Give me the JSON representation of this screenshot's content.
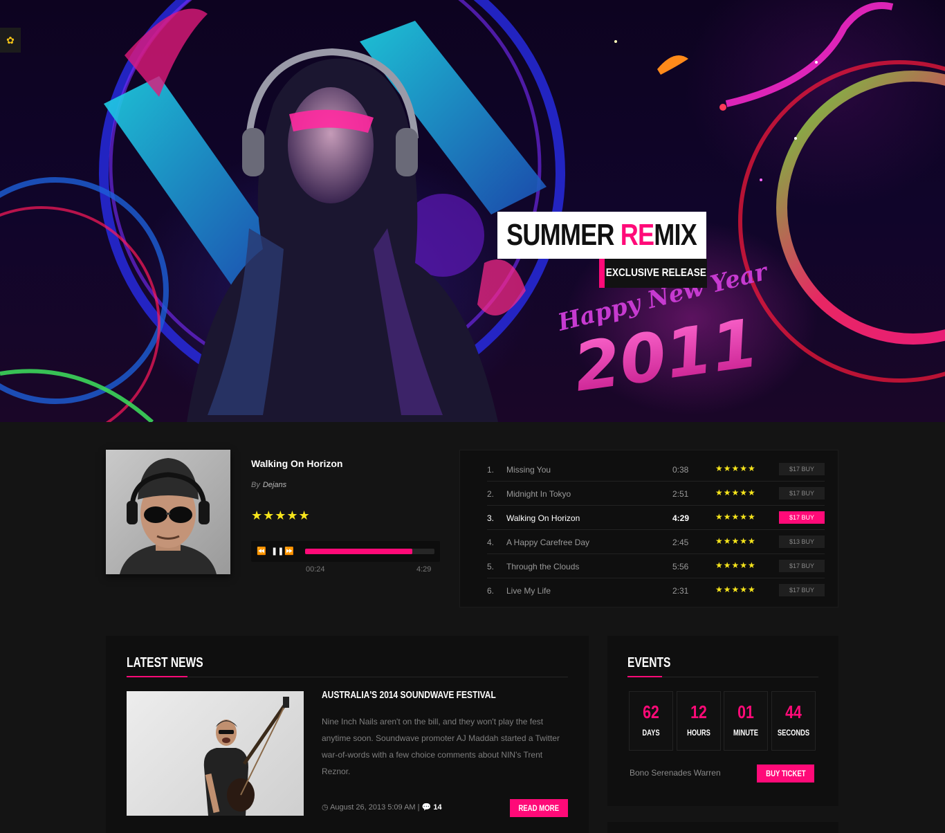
{
  "hero": {
    "title_part1": "SUMMER ",
    "title_accent": "RE",
    "title_part2": "MIX",
    "subtitle": "EXCLUSIVE RELEASE",
    "art_text_line1": "Happy New Year",
    "art_text_year": "2011",
    "side_widget_icon": "flower-icon"
  },
  "player": {
    "title": "Walking On Horizon",
    "by_label": "By",
    "artist": "Dejans",
    "rating": "★★★★★",
    "rating_value": 5,
    "prev_icon": "⏪",
    "pause_icon": "❚❚",
    "next_icon": "⏩",
    "progress_fraction": 0.83,
    "time_current": "00:24",
    "time_total": "4:29"
  },
  "playlist": {
    "tracks": [
      {
        "num": "1.",
        "name": "Missing You",
        "duration": "0:38",
        "rating": "★★★★★",
        "buy": "$17 BUY"
      },
      {
        "num": "2.",
        "name": "Midnight In Tokyo",
        "duration": "2:51",
        "rating": "★★★★★",
        "buy": "$17 BUY"
      },
      {
        "num": "3.",
        "name": "Walking On Horizon",
        "duration": "4:29",
        "rating": "★★★★★",
        "buy": "$17 BUY"
      },
      {
        "num": "4.",
        "name": "A Happy Carefree Day",
        "duration": "2:45",
        "rating": "★★★★★",
        "buy": "$13 BUY"
      },
      {
        "num": "5.",
        "name": "Through the Clouds",
        "duration": "5:56",
        "rating": "★★★★★",
        "buy": "$17 BUY"
      },
      {
        "num": "6.",
        "name": "Live My Life",
        "duration": "2:31",
        "rating": "★★★★★",
        "buy": "$17 BUY"
      }
    ],
    "active_index": 2
  },
  "news": {
    "section_title": "LATEST NEWS",
    "headline": "AUSTRALIA'S 2014 SOUNDWAVE FESTIVAL",
    "body": "Nine Inch Nails aren't on the bill, and they won't play the fest anytime soon. Soundwave promoter AJ Maddah started a Twitter war-of-words with a few choice comments about NIN's Trent Reznor.",
    "date": "August 26, 2013 5:09 AM",
    "separator": "|",
    "comments": "14",
    "read_more": "READ MORE"
  },
  "events": {
    "section_title": "EVENTS",
    "countdown": [
      {
        "value": "62",
        "label": "DAYS"
      },
      {
        "value": "12",
        "label": "HOURS"
      },
      {
        "value": "01",
        "label": "MINUTE"
      },
      {
        "value": "44",
        "label": "SECONDS"
      }
    ],
    "event_name": "Bono Serenades Warren",
    "buy_ticket": "BUY TICKET"
  },
  "colors": {
    "accent": "#ff0a78",
    "star": "#f7e51c",
    "background": "#141414",
    "panel": "#0f0f0f"
  }
}
